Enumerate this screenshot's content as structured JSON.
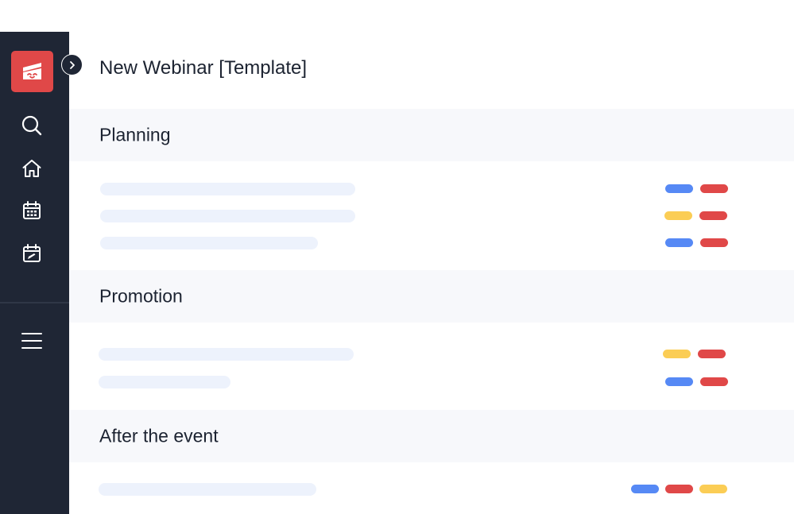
{
  "colors": {
    "sidebar": "#1f2635",
    "logo": "#e04848",
    "blue": "#5689f5",
    "red": "#e04848",
    "yellow": "#fbcd55",
    "row_placeholder": "#edf2fc",
    "section_bg": "#f7f8fb"
  },
  "sidebar": {
    "logo_icon": "app-logo-icon",
    "items": [
      {
        "icon": "search-icon"
      },
      {
        "icon": "home-icon"
      },
      {
        "icon": "calendar-icon"
      },
      {
        "icon": "calendar-edit-icon"
      }
    ],
    "menu_icon": "hamburger-menu-icon",
    "toggle_icon": "chevron-right-icon"
  },
  "page": {
    "title": "New Webinar [Template]"
  },
  "sections": [
    {
      "title": "Planning",
      "rows": [
        {
          "tags": [
            "blue",
            "red"
          ]
        },
        {
          "tags": [
            "yellow",
            "red"
          ]
        },
        {
          "tags": [
            "blue",
            "red"
          ]
        }
      ]
    },
    {
      "title": "Promotion",
      "rows": [
        {
          "tags": [
            "yellow",
            "red"
          ]
        },
        {
          "tags": [
            "blue",
            "red"
          ]
        }
      ]
    },
    {
      "title": "After the event",
      "rows": [
        {
          "tags": [
            "blue",
            "red",
            "yellow"
          ]
        }
      ]
    }
  ]
}
